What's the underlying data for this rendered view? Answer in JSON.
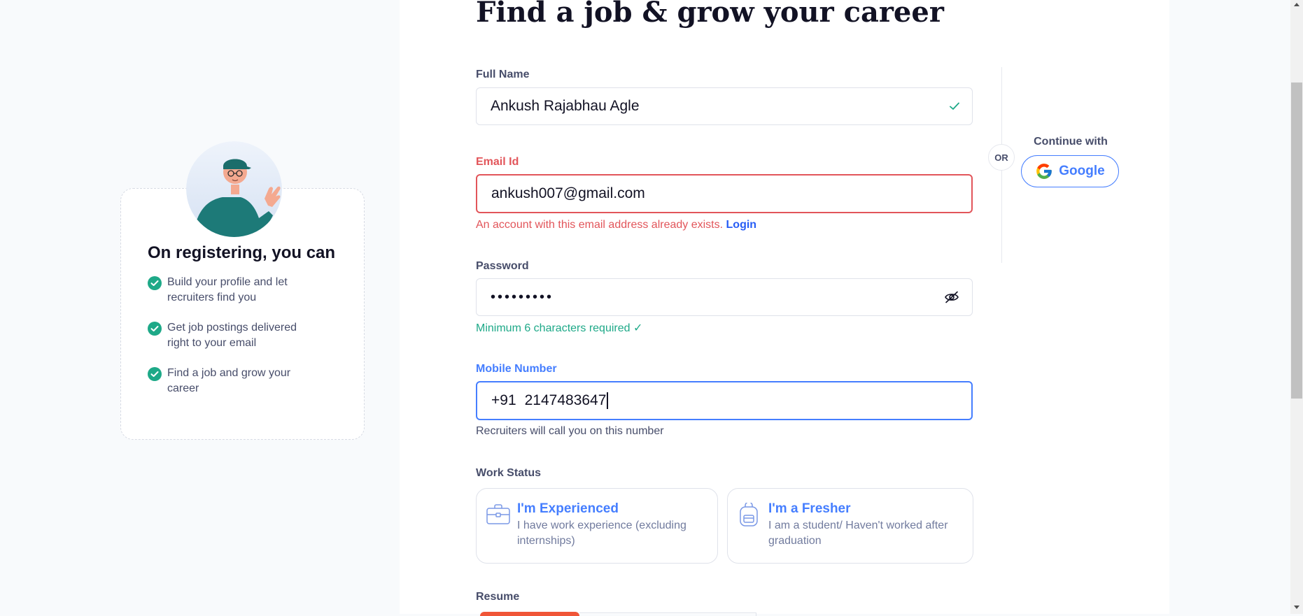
{
  "page": {
    "heading": "Find a job & grow your career"
  },
  "form": {
    "full_name": {
      "label": "Full Name",
      "value": "Ankush Rajabhau Agle",
      "status_icon": "checkmark-icon"
    },
    "email": {
      "label": "Email Id",
      "value": "ankush007@gmail.com",
      "error_text": "An account with this email address already exists.",
      "error_link": "Login"
    },
    "password": {
      "label": "Password",
      "masked_value": "•••••••••",
      "toggle_icon": "eye-slash-icon",
      "hint": "Minimum 6 characters required ✓"
    },
    "mobile": {
      "label": "Mobile Number",
      "country_code": "+91",
      "value": "2147483647",
      "hint": "Recruiters will call you on this number"
    },
    "work_status": {
      "label": "Work Status",
      "options": [
        {
          "title": "I'm Experienced",
          "subtitle": "I have work experience (excluding internships)",
          "icon": "briefcase-icon"
        },
        {
          "title": "I'm a Fresher",
          "subtitle": "I am a student/ Haven't worked after graduation",
          "icon": "backpack-icon"
        }
      ]
    },
    "resume": {
      "label": "Resume"
    }
  },
  "social": {
    "or_text": "OR",
    "continue_label": "Continue with",
    "google_label": "Google"
  },
  "sidebar": {
    "title": "On registering, you can",
    "benefits": [
      "Build your profile and let recruiters find you",
      "Get job postings delivered right to your email",
      "Find a job and grow your career"
    ]
  },
  "colors": {
    "accent": "#457eff",
    "error": "#e2555a",
    "success": "#1ea988",
    "text": "#121224",
    "muted": "#474d6a"
  }
}
